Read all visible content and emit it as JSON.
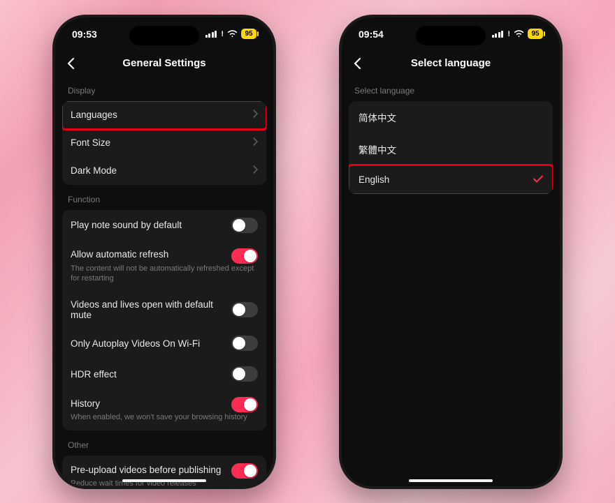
{
  "phone1": {
    "status": {
      "time": "09:53",
      "battery": "95"
    },
    "title": "General Settings",
    "sections": {
      "display": {
        "label": "Display",
        "languages": "Languages",
        "fontSize": "Font Size",
        "darkMode": "Dark Mode"
      },
      "function": {
        "label": "Function",
        "playNote": {
          "title": "Play note sound by default",
          "on": false
        },
        "autoRefresh": {
          "title": "Allow automatic refresh",
          "sub": "The content will not be automatically refreshed except for restarting",
          "on": true
        },
        "defaultMute": {
          "title": "Videos and lives open with default mute",
          "on": false
        },
        "autoplayWifi": {
          "title": "Only Autoplay Videos On Wi-Fi",
          "on": false
        },
        "hdr": {
          "title": "HDR effect",
          "on": false
        },
        "history": {
          "title": "History",
          "sub": "When enabled,  we won't save your browsing history",
          "on": true
        }
      },
      "other": {
        "label": "Other",
        "preupload": {
          "title": "Pre-upload videos before publishing",
          "sub": "Reduce wait times for video releases",
          "on": true
        }
      }
    }
  },
  "phone2": {
    "status": {
      "time": "09:54",
      "battery": "95"
    },
    "title": "Select language",
    "sectionLabel": "Select language",
    "options": {
      "zhSimplified": "简体中文",
      "zhTraditional": "繁體中文",
      "english": "English"
    },
    "selected": "english"
  },
  "colors": {
    "accent": "#fe2c55",
    "highlight": "#e60012",
    "battery": "#ffd60a"
  }
}
